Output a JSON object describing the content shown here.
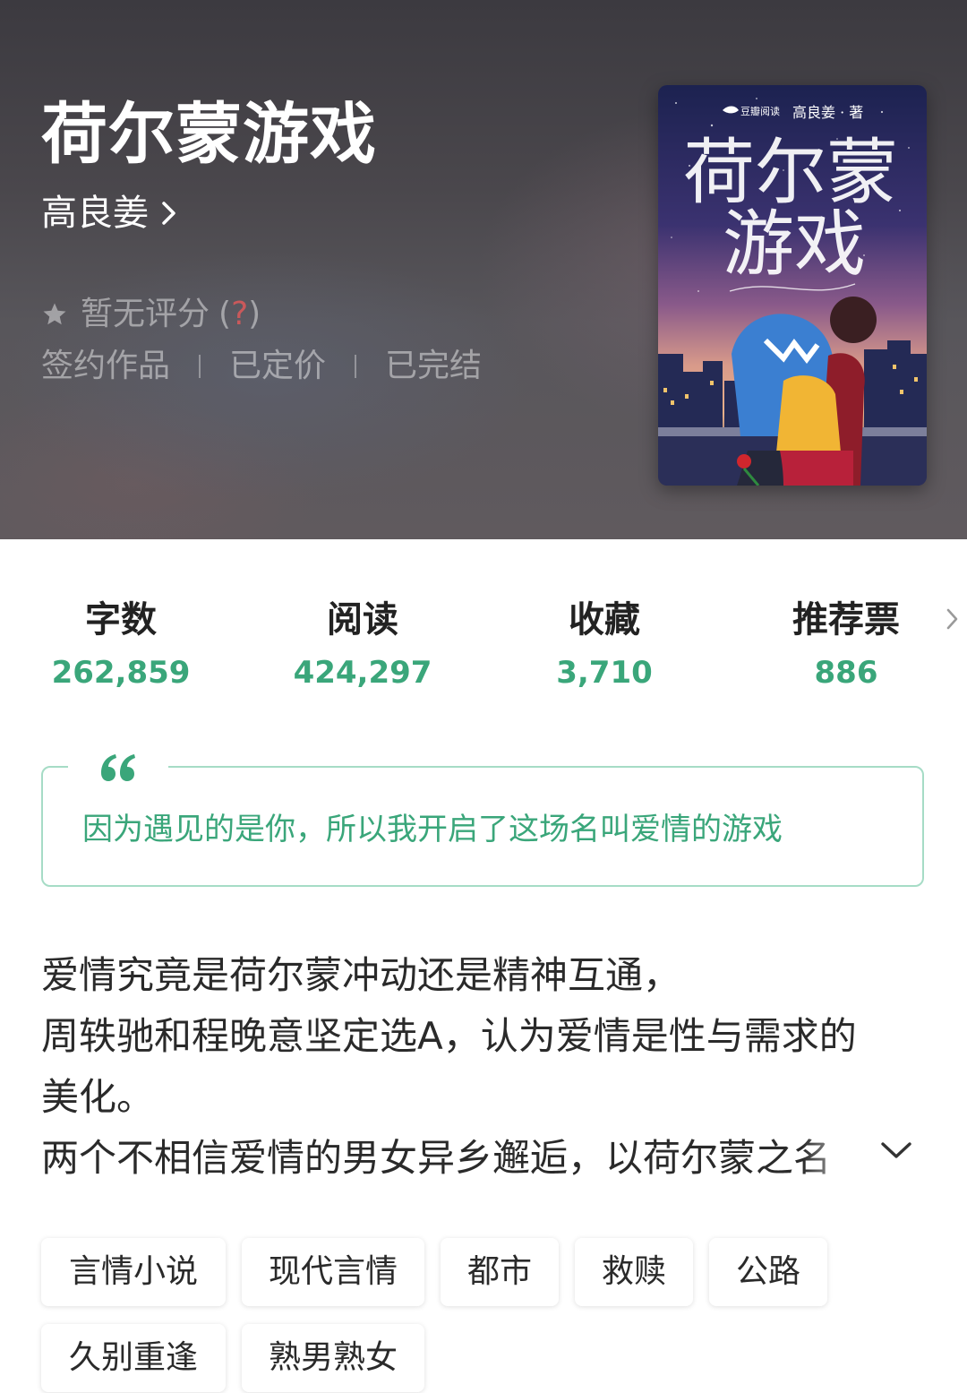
{
  "book": {
    "title": "荷尔蒙游戏",
    "author": "高良姜",
    "rating_text": "暂无评分",
    "rating_help_open": "(",
    "rating_help_q": "?",
    "rating_help_close": ")",
    "meta": [
      "签约作品",
      "已定价",
      "已完结"
    ]
  },
  "cover": {
    "publisher": "豆瓣阅读",
    "byline": "高良姜 · 著",
    "title_line1": "荷尔蒙",
    "title_line2": "游戏"
  },
  "stats": [
    {
      "label": "字数",
      "value": "262,859"
    },
    {
      "label": "阅读",
      "value": "424,297"
    },
    {
      "label": "收藏",
      "value": "3,710"
    },
    {
      "label": "推荐票",
      "value": "886"
    }
  ],
  "quote": {
    "text": "因为遇见的是你，所以我开启了这场名叫爱情的游戏"
  },
  "description": {
    "lines": [
      "爱情究竟是荷尔蒙冲动还是精神互通，",
      "周轶驰和程晚意坚定选A，认为爱情是性与需求的",
      "美化。",
      "两个不相信爱情的男女异乡邂逅，以荷尔蒙之名"
    ]
  },
  "tags": [
    "言情小说",
    "现代言情",
    "都市",
    "救赎",
    "公路",
    "久别重逢",
    "熟男熟女"
  ],
  "colors": {
    "accent": "#3aa67a",
    "quote_border": "#a6dcc6",
    "help_q": "#c9595b"
  },
  "icons": {
    "author_arrow": "chevron-right-icon",
    "rating_star": "star-icon",
    "stats_arrow": "chevron-right-icon",
    "quote": "quote-icon",
    "expand": "chevron-down-icon"
  }
}
